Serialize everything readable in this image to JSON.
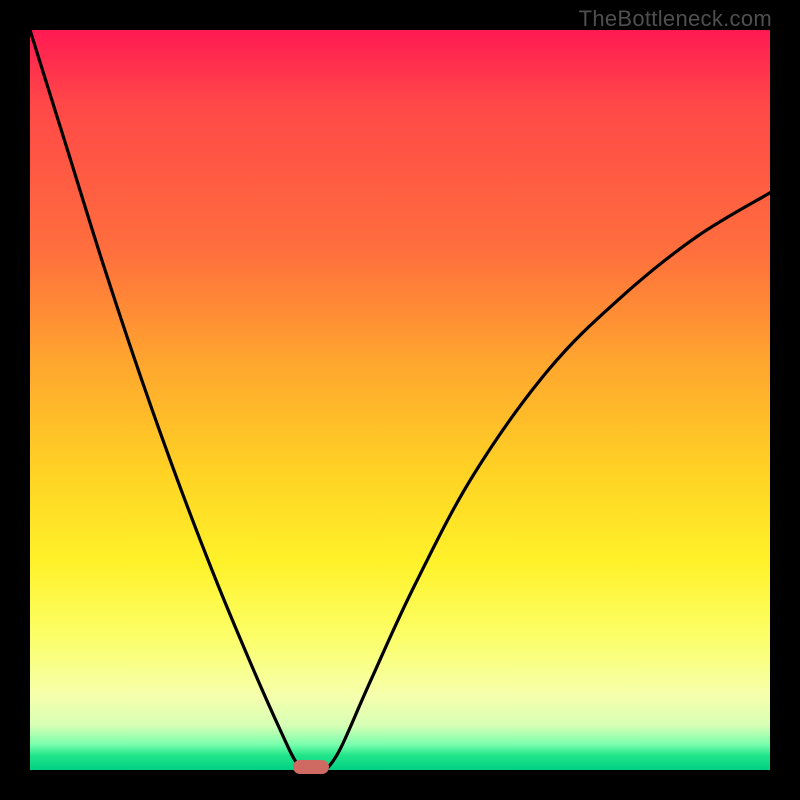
{
  "watermark": "TheBottleneck.com",
  "chart_data": {
    "type": "line",
    "title": "",
    "xlabel": "",
    "ylabel": "",
    "xlim": [
      0,
      100
    ],
    "ylim": [
      0,
      100
    ],
    "grid": false,
    "legend": false,
    "series": [
      {
        "name": "left-branch",
        "x": [
          0,
          5,
          10,
          15,
          20,
          25,
          30,
          34,
          36,
          37.5
        ],
        "y": [
          100,
          84,
          68,
          53,
          39,
          26,
          14,
          5,
          1,
          0
        ]
      },
      {
        "name": "right-branch",
        "x": [
          40,
          42,
          46,
          52,
          60,
          70,
          80,
          90,
          100
        ],
        "y": [
          0,
          3,
          12,
          25,
          40,
          54,
          64,
          72,
          78
        ]
      }
    ],
    "annotations": [
      {
        "name": "optimal-flat-marker",
        "x": 38,
        "y": 0
      }
    ],
    "gradient_stops": [
      {
        "pos": 0.0,
        "color": "#ff1a52"
      },
      {
        "pos": 0.3,
        "color": "#ff6f3d"
      },
      {
        "pos": 0.6,
        "color": "#ffd324"
      },
      {
        "pos": 0.82,
        "color": "#fcff68"
      },
      {
        "pos": 0.96,
        "color": "#7cffae"
      },
      {
        "pos": 1.0,
        "color": "#00d084"
      }
    ]
  },
  "colors": {
    "frame": "#000000",
    "curve": "#000000",
    "marker": "#cf6a62",
    "watermark": "#4f4f4f"
  }
}
